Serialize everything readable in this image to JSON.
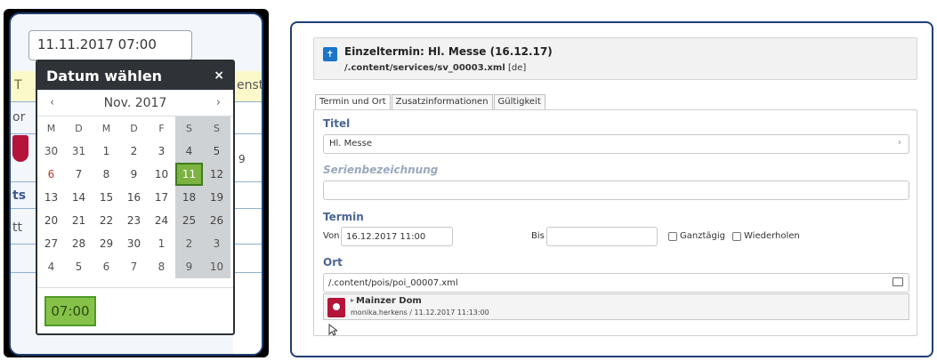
{
  "left": {
    "date_input_value": "11.11.2017 07:00",
    "bg_fragments": [
      "T",
      "enst",
      "or",
      "9",
      "ts",
      "tt"
    ],
    "datepicker": {
      "title": "Datum wählen",
      "close": "×",
      "prev": "‹",
      "next": "›",
      "month_label": "Nov. 2017",
      "weekdays": [
        "M",
        "D",
        "M",
        "D",
        "F",
        "S",
        "S"
      ],
      "weeks": [
        [
          "30",
          "31",
          "1",
          "2",
          "3",
          "4",
          "5"
        ],
        [
          "6",
          "7",
          "8",
          "9",
          "10",
          "11",
          "12"
        ],
        [
          "13",
          "14",
          "15",
          "16",
          "17",
          "18",
          "19"
        ],
        [
          "20",
          "21",
          "22",
          "23",
          "24",
          "25",
          "26"
        ],
        [
          "27",
          "28",
          "29",
          "30",
          "1",
          "2",
          "3"
        ],
        [
          "4",
          "5",
          "6",
          "7",
          "8",
          "9",
          "10"
        ]
      ],
      "selected_day": "11",
      "time": "07:00"
    }
  },
  "right": {
    "header": {
      "title": "Einzeltermin: Hl. Messe (16.12.17)",
      "path": "/.content/services/sv_00003.xml",
      "locale": "[de]"
    },
    "tabs": [
      "Termin und Ort",
      "Zusatzinformationen",
      "Gültigkeit"
    ],
    "titel_label": "Titel",
    "titel_value": "Hl. Messe",
    "serien_label": "Serienbezeichnung",
    "serien_value": "",
    "termin_label": "Termin",
    "von_label": "Von",
    "von_value": "16.12.2017 11:00",
    "bis_label": "Bis",
    "bis_value": "",
    "ganztaegig_label": "Ganztägig",
    "wiederholen_label": "Wiederholen",
    "ort_label": "Ort",
    "ort_value": "/.content/pois/poi_00007.xml",
    "poi": {
      "name": "Mainzer Dom",
      "meta": "monika.herkens / 11.12.2017 11:13:00"
    }
  },
  "colors": {
    "border_blue": "#1f3f73",
    "datepicker_header": "#2f3337",
    "selected_green": "#7cb342",
    "label_blue": "#4a6590",
    "poi_red": "#b4133a"
  }
}
